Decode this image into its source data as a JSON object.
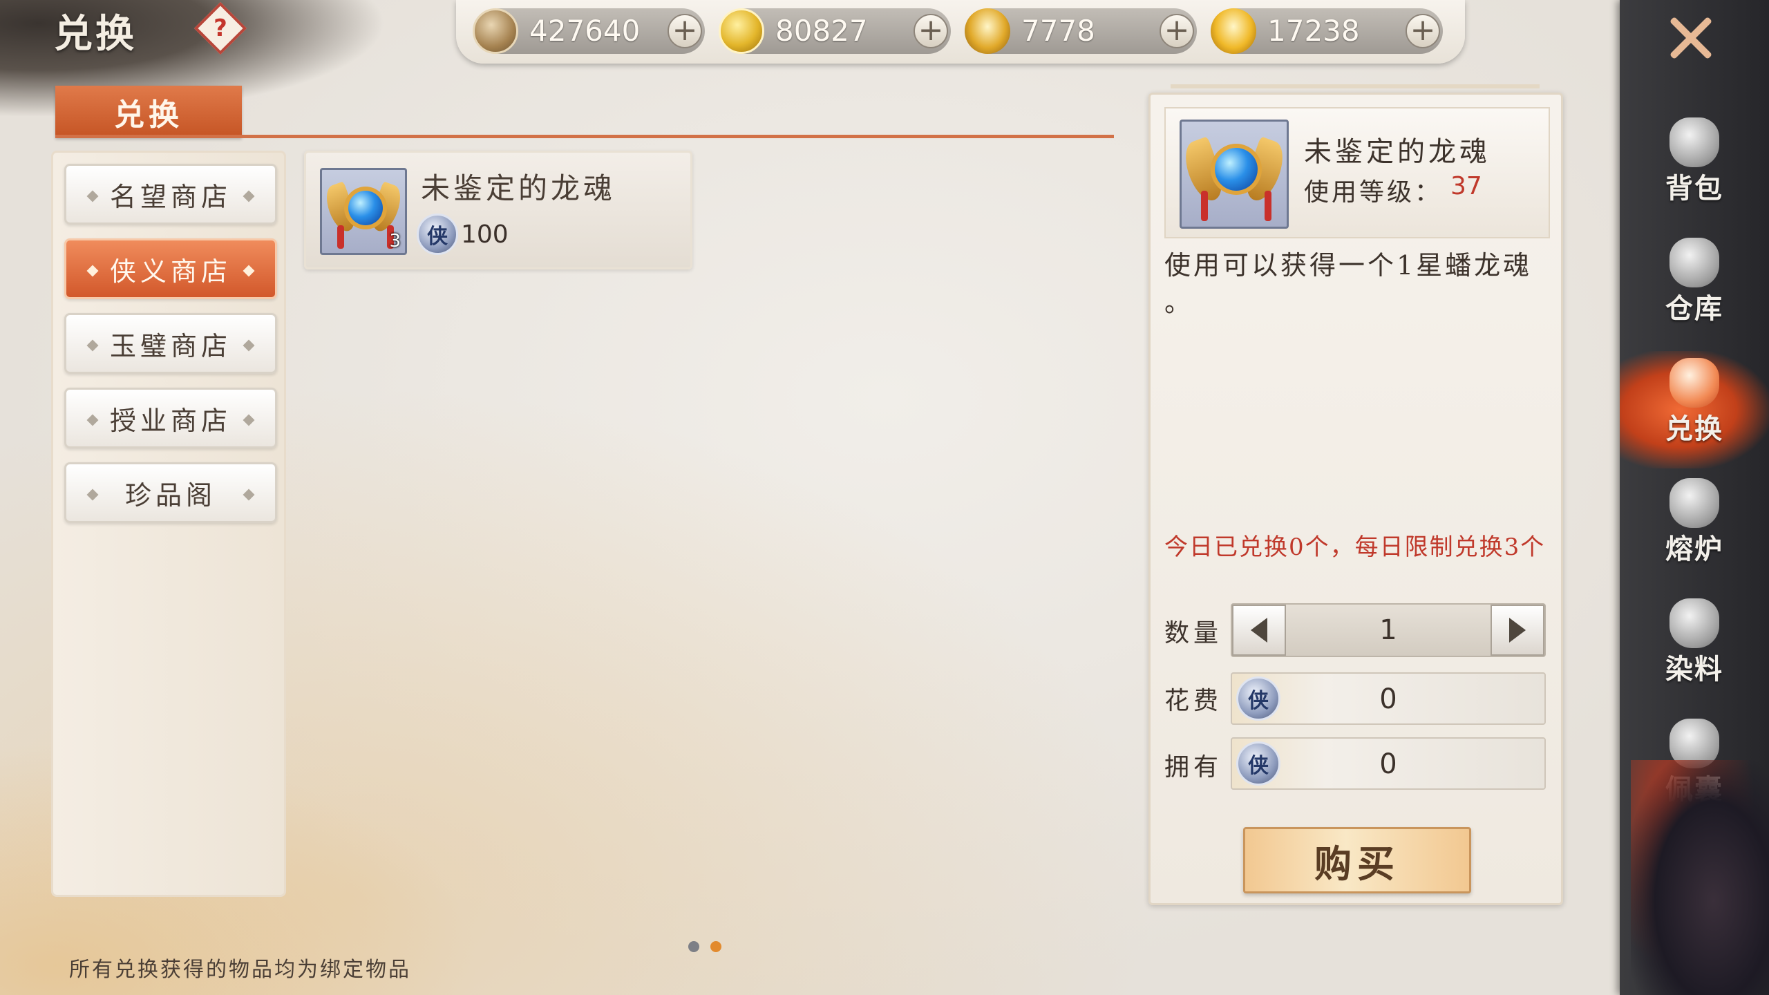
{
  "header": {
    "title": "兑换",
    "help_icon": "question-diamond-icon"
  },
  "currencies": [
    {
      "name": "copper",
      "icon": "copper-coin-icon",
      "value": "427640"
    },
    {
      "name": "gold",
      "icon": "gold-coin-icon",
      "value": "80827"
    },
    {
      "name": "bound-ingot",
      "icon": "bound-ingot-icon",
      "value": "7778"
    },
    {
      "name": "ingot",
      "icon": "gold-ingot-icon",
      "value": "17238"
    }
  ],
  "main_tab": {
    "label": "兑换"
  },
  "shops": [
    {
      "label": "名望商店",
      "active": false
    },
    {
      "label": "侠义商店",
      "active": true
    },
    {
      "label": "玉璧商店",
      "active": false
    },
    {
      "label": "授业商店",
      "active": false
    },
    {
      "label": "珍品阁",
      "active": false
    }
  ],
  "items": [
    {
      "name": "未鉴定的龙魂",
      "count": "3",
      "price": "100",
      "currency_icon": "xia-token-icon",
      "currency_glyph": "侠"
    }
  ],
  "detail": {
    "name": "未鉴定的龙魂",
    "level_label": "使用等级：",
    "level_value": "37",
    "description": "使用可以获得一个1星蟠龙魂 。",
    "limit_text": "今日已兑换0个，每日限制兑换3个",
    "quantity_label": "数量",
    "quantity_value": "1",
    "cost_label": "花费",
    "cost_value": "0",
    "own_label": "拥有",
    "own_value": "0",
    "token_glyph": "侠",
    "buy_label": "购买"
  },
  "pagination": {
    "total": 2,
    "current": 2
  },
  "footer_note": "所有兑换获得的物品均为绑定物品",
  "nav": [
    {
      "label": "背包",
      "icon": "bag-icon",
      "active": false
    },
    {
      "label": "仓库",
      "icon": "warehouse-icon",
      "active": false
    },
    {
      "label": "兑换",
      "icon": "exchange-icon",
      "active": true
    },
    {
      "label": "熔炉",
      "icon": "furnace-icon",
      "active": false
    },
    {
      "label": "染料",
      "icon": "dye-icon",
      "active": false
    },
    {
      "label": "佩囊",
      "icon": "pouch-icon",
      "active": false
    }
  ],
  "colors": {
    "accent_orange": "#d2582b",
    "highlight_red": "#c0392b",
    "nav_bg": "#2e2e32"
  }
}
